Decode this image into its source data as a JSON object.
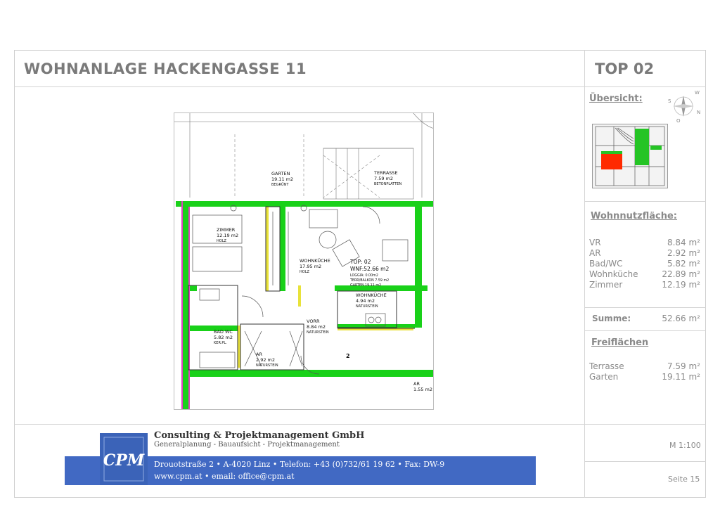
{
  "header": {
    "title": "WOHNANLAGE HACKENGASSE 11",
    "unit": "TOP 02"
  },
  "sidebar": {
    "overview_label": "Übersicht:",
    "area_heading": "Wohnnutzfläche:",
    "rooms": [
      {
        "label": "VR",
        "value": "8.84 m²"
      },
      {
        "label": "AR",
        "value": "2.92 m²"
      },
      {
        "label": "Bad/WC",
        "value": "5.82 m²"
      },
      {
        "label": "Wohnküche",
        "value": "22.89 m²"
      },
      {
        "label": "Zimmer",
        "value": "12.19 m²"
      }
    ],
    "sum_label": "Summe:",
    "sum_value": "52.66 m²",
    "outdoor_heading": "Freiflächen",
    "outdoor": [
      {
        "label": "Terrasse",
        "value": "7.59 m²"
      },
      {
        "label": "Garten",
        "value": "19.11 m²"
      }
    ],
    "scale": "M 1:100",
    "page": "Seite 15"
  },
  "plan": {
    "rooms": [
      {
        "name": "GARTEN",
        "area": "19.11 m2",
        "floor": "BEGRÜNT"
      },
      {
        "name": "TERRASSE",
        "area": "7.59 m2",
        "floor": "BETONPLATTEN"
      },
      {
        "name": "ZIMMER",
        "area": "12.19 m2",
        "floor": "HOLZ"
      },
      {
        "name": "WOHNKÜCHE",
        "area": "17.95 m2",
        "floor": "HOLZ"
      },
      {
        "name": "WOHNKÜCHE",
        "area": "4.94 m2",
        "floor": "NATURSTEIN"
      },
      {
        "name": "BAD WC",
        "area": "5.82 m2",
        "floor": "KER.PL."
      },
      {
        "name": "VORR",
        "area": "8.84 m2",
        "floor": "NATURSTEIN"
      },
      {
        "name": "AR",
        "area": "2.92 m2",
        "floor": "NATURSTEIN"
      },
      {
        "name": "AR",
        "area": "1.55 m2",
        "floor": ""
      }
    ],
    "summary": {
      "top": "TOP: 02",
      "wnf": "WNF:52.66 m2",
      "loggia": "LOGGIA: 0.00m2",
      "terr": "TERR/BALKON 7.59 m2",
      "garten": "GARTEN 19.11 m2"
    },
    "stair_number": "2"
  },
  "footer": {
    "company": "Consulting & Projektmanagement GmbH",
    "subtitle": "Generalplanung - Bauaufsicht - Projektmanagement",
    "address": "Drouotstraße 2 • A-4020 Linz • Telefon: +43 (0)732/61 19 62 • Fax: DW-9",
    "web": "www.cpm.at • email: office@cpm.at",
    "logo_text": "CPM"
  },
  "colors": {
    "wall_green": "#19d119",
    "highlight_red": "#ff2a00",
    "brand_blue": "#4169c3"
  }
}
